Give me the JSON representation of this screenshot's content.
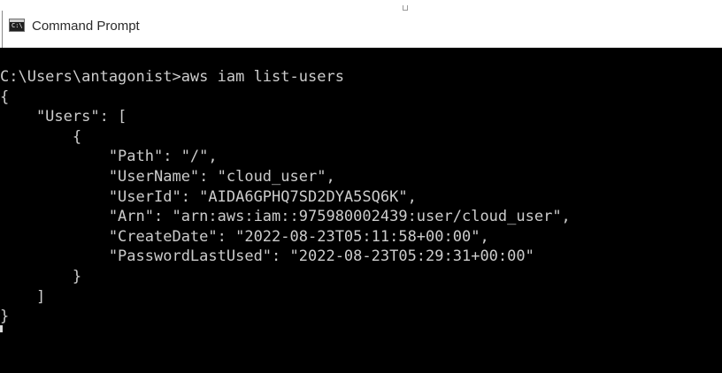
{
  "window": {
    "title": "Command Prompt",
    "app_icon": "cmd-icon",
    "app_icon_label": "C:\\"
  },
  "console": {
    "background_color": "#000000",
    "text_color": "#cccccc",
    "lines": [
      "C:\\Users\\antagonist>aws iam list-users",
      "{",
      "    \"Users\": [",
      "        {",
      "            \"Path\": \"/\",",
      "            \"UserName\": \"cloud_user\",",
      "            \"UserId\": \"AIDA6GPHQ7SD2DYA5SQ6K\",",
      "            \"Arn\": \"arn:aws:iam::975980002439:user/cloud_user\",",
      "            \"CreateDate\": \"2022-08-23T05:11:58+00:00\",",
      "            \"PasswordLastUsed\": \"2022-08-23T05:29:31+00:00\"",
      "        }",
      "    ]",
      "}"
    ]
  }
}
